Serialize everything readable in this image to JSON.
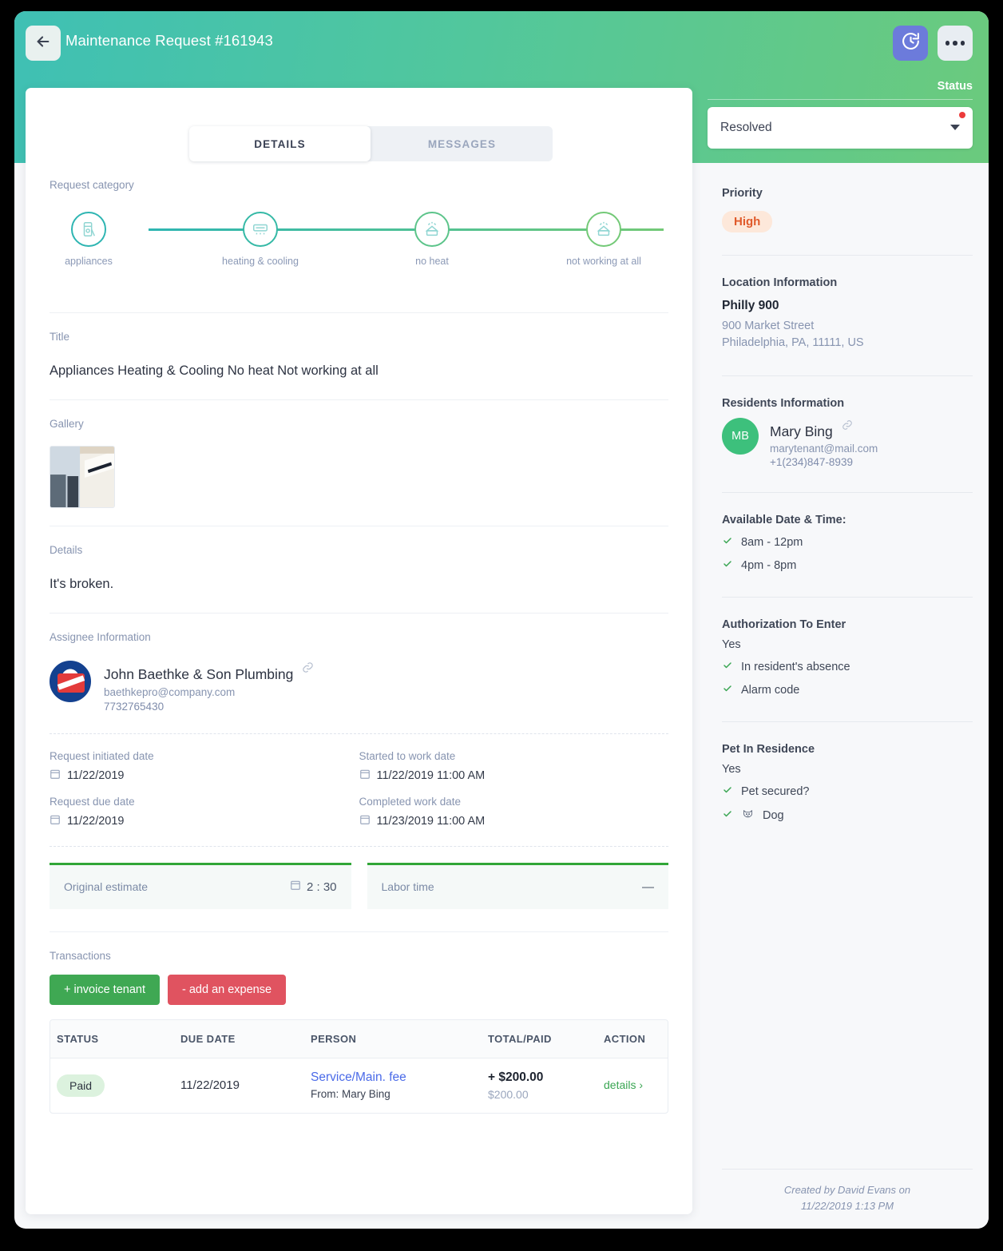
{
  "header": {
    "title": "Maintenance Request #161943",
    "back_icon": "arrow-left-icon",
    "history_icon": "history-clock-icon",
    "more_icon": "ellipsis-icon",
    "status_label": "Status",
    "status_value": "Resolved",
    "has_unsaved_dot": true,
    "gradient_from": "#3fc0b4",
    "gradient_to": "#6bca7d"
  },
  "tabs": [
    {
      "label": "DETAILS",
      "active": true
    },
    {
      "label": "MESSAGES",
      "active": false
    }
  ],
  "details": {
    "category_label": "Request category",
    "steps": [
      {
        "label": "appliances",
        "icon": "appliance-icon",
        "color": "#2eb5b2"
      },
      {
        "label": "heating & cooling",
        "icon": "ac-unit-icon",
        "color": "#35b9a6"
      },
      {
        "label": "no heat",
        "icon": "heat-off-icon",
        "color": "#5cc48a"
      },
      {
        "label": "not working at all",
        "icon": "heat-off-icon",
        "color": "#73c977"
      }
    ],
    "title_label": "Title",
    "title_value": "Appliances Heating & Cooling No heat Not working at all",
    "gallery_label": "Gallery",
    "gallery_count": 1,
    "details_label": "Details",
    "details_value": "It's broken.",
    "assignee_label": "Assignee Information",
    "assignee": {
      "name": "John Baethke & Son Plumbing",
      "email": "baethkepro@company.com",
      "phone": "7732765430",
      "logo": "plumbing-company-logo"
    },
    "dates": [
      {
        "label": "Request initiated date",
        "value": "11/22/2019"
      },
      {
        "label": "Started to work date",
        "value": "11/22/2019 11:00 AM"
      },
      {
        "label": "Request due date",
        "value": "11/22/2019"
      },
      {
        "label": "Completed work date",
        "value": "11/23/2019 11:00 AM"
      }
    ],
    "estimates": [
      {
        "label": "Original estimate",
        "value": "2 : 30",
        "has_icon": true
      },
      {
        "label": "Labor time",
        "value": "—",
        "has_icon": false
      }
    ]
  },
  "transactions": {
    "label": "Transactions",
    "invoice_button": "+ invoice tenant",
    "expense_button": "- add an expense",
    "columns": [
      "STATUS",
      "DUE DATE",
      "PERSON",
      "TOTAL/PAID",
      "ACTION"
    ],
    "rows": [
      {
        "status": "Paid",
        "due_date": "11/22/2019",
        "person": "Service/Main. fee",
        "person_from": "From: Mary Bing",
        "total": "+ $200.00",
        "paid": "$200.00",
        "action": "details ›"
      }
    ]
  },
  "sidebar": {
    "priority_label": "Priority",
    "priority_value": "High",
    "location_label": "Location Information",
    "location_name": "Philly 900",
    "location_street": "900 Market Street",
    "location_city": "Philadelphia, PA, 11111, US",
    "residents_label": "Residents Information",
    "resident": {
      "initials": "MB",
      "name": "Mary Bing",
      "email": "marytenant@mail.com",
      "phone": "+1(234)847-8939"
    },
    "available_label": "Available Date & Time:",
    "available_slots": [
      "8am - 12pm",
      "4pm - 8pm"
    ],
    "auth_label": "Authorization To Enter",
    "auth_value": "Yes",
    "auth_items": [
      "In resident's absence",
      "Alarm code"
    ],
    "pet_label": "Pet In Residence",
    "pet_value": "Yes",
    "pet_items": [
      "Pet secured?",
      "Dog"
    ],
    "created_line1": "Created by David Evans on",
    "created_line2": "11/22/2019 1:13 PM"
  }
}
